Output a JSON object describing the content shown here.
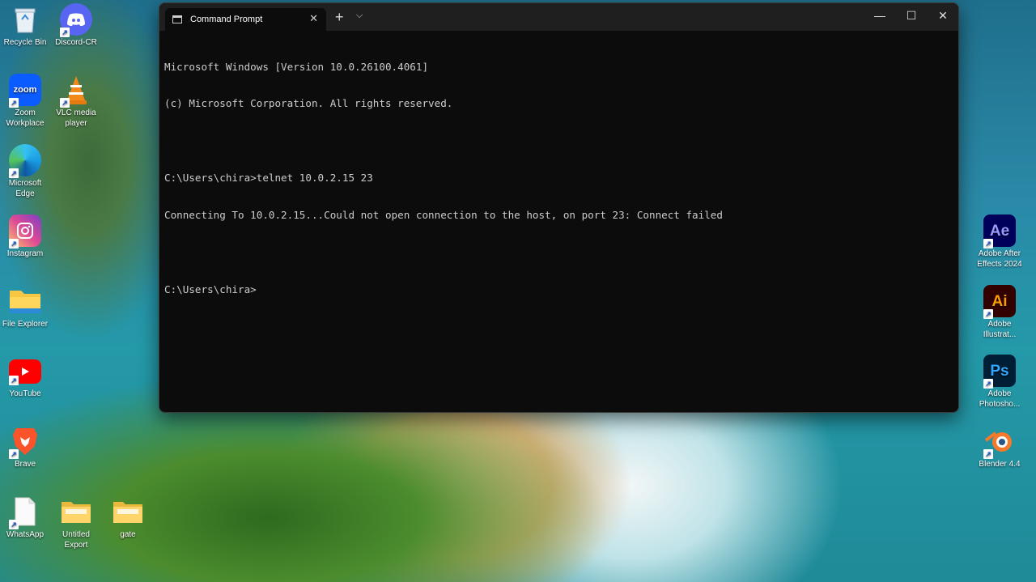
{
  "desktop": {
    "left_icons": [
      {
        "label": "Recycle Bin",
        "icon": "recycle-bin-icon"
      },
      {
        "label": "Discord-CR",
        "icon": "discord-icon"
      },
      {
        "label": "Zoom Workplace",
        "icon": "zoom-icon"
      },
      {
        "label": "VLC media player",
        "icon": "vlc-icon"
      },
      {
        "label": "Microsoft Edge",
        "icon": "edge-icon"
      },
      {
        "label": "Instagram",
        "icon": "instagram-icon"
      },
      {
        "label": "File Explorer",
        "icon": "folder-icon"
      },
      {
        "label": "YouTube",
        "icon": "youtube-icon"
      },
      {
        "label": "Brave",
        "icon": "brave-icon"
      },
      {
        "label": "WhatsApp",
        "icon": "document-icon"
      },
      {
        "label": "Untitled Export",
        "icon": "folder-icon"
      },
      {
        "label": "gate",
        "icon": "folder-icon"
      }
    ],
    "right_icons": [
      {
        "label": "Adobe After Effects 2024",
        "badge": "Ae"
      },
      {
        "label": "Adobe Illustrat...",
        "badge": "Ai"
      },
      {
        "label": "Adobe Photosho...",
        "badge": "Ps"
      },
      {
        "label": "Blender 4.4",
        "icon": "blender-icon"
      }
    ]
  },
  "window": {
    "tab_title": "Command Prompt",
    "new_tab": "+",
    "dropdown": "⌵",
    "minimize": "—",
    "maximize": "☐",
    "close": "✕",
    "tab_close": "✕"
  },
  "terminal": {
    "lines": [
      "Microsoft Windows [Version 10.0.26100.4061]",
      "(c) Microsoft Corporation. All rights reserved.",
      "",
      "C:\\Users\\chira>telnet 10.0.2.15 23",
      "Connecting To 10.0.2.15...Could not open connection to the host, on port 23: Connect failed",
      "",
      "C:\\Users\\chira>"
    ]
  },
  "colors": {
    "terminal_bg": "#0c0c0c",
    "terminal_fg": "#cccccc",
    "titlebar_bg": "#1f1f1f"
  }
}
